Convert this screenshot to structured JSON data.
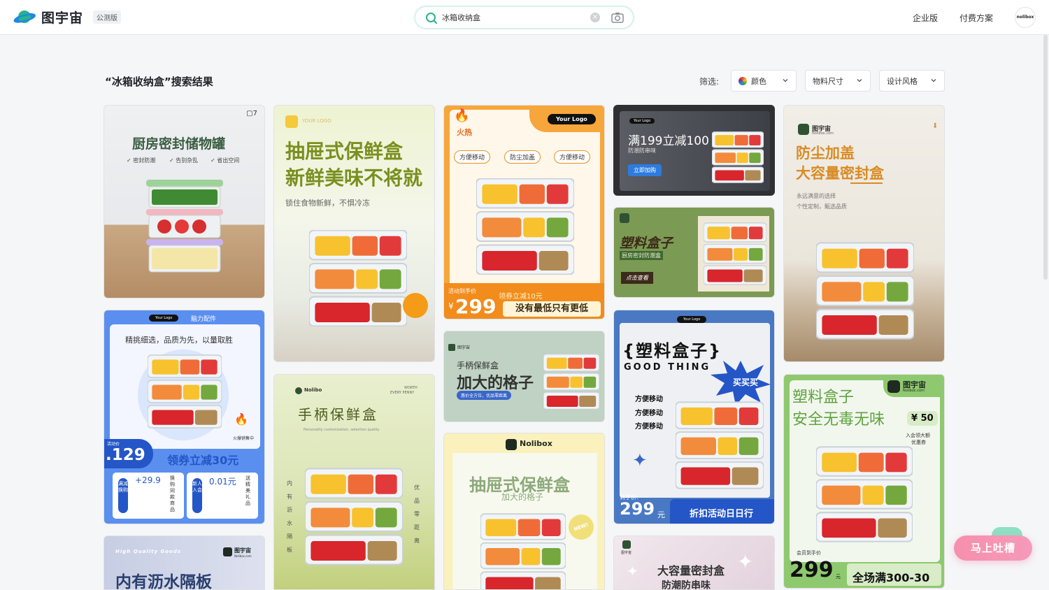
{
  "header": {
    "brand": "图宇宙",
    "badge": "公测版",
    "search_value": "冰箱收纳盒",
    "clear_symbol": "×",
    "links": [
      "企业版",
      "付费方案"
    ],
    "avatar_text": "nolibox"
  },
  "results": {
    "title": "“冰箱收纳盒”搜索结果",
    "filter_label": "筛选:",
    "filters": [
      "颜色",
      "物料尺寸",
      "设计风格"
    ]
  },
  "cards": {
    "c1": {
      "page_count": "7",
      "title": "厨房密封储物罐",
      "tags": [
        "密封防潮",
        "告别杂乱",
        "省出空间"
      ]
    },
    "c2": {
      "logo": "YOUR LOGO",
      "title1": "抽屉式保鲜盒",
      "title2": "新鲜美味不将就",
      "subtitle": "锁住食物新鲜，不惧冷冻"
    },
    "c3": {
      "badge": "火热",
      "tags": [
        "方便移动",
        "防尘加盖",
        "方便移动"
      ],
      "logo": "Your Logo",
      "price_label": "活动到手价",
      "price": "299",
      "currency": "¥",
      "coupon": "领券立减10元",
      "slogan": "没有最低只有更低"
    },
    "c4": {
      "logo": "Your Logo",
      "title": "满199立减100",
      "subtitle": "防潮防串味",
      "button": "立即加购"
    },
    "c5": {
      "brand": "图宇宙",
      "brand_sub": "Nolibox.com",
      "title1": "防尘加盖",
      "title2": "大容量密封盒",
      "line1": "永远满意的选择",
      "line2": "个性定制，甄选品质"
    },
    "c6": {
      "logo": "Your Logo",
      "category": "脑力配件",
      "headline": "精挑细选，品质为先，以量取胜",
      "hot": "火爆销售中",
      "price_label": "活动价",
      "price": ".129",
      "coupon": "领券立减30元",
      "offer1_tag": "满减换购",
      "offer1_price": "+29.9",
      "offer1_desc": "换购同款商品",
      "offer2_tag": "新人入会",
      "offer2_price": "0.01元",
      "offer2_desc": "送精美礼品"
    },
    "c7": {
      "brand": "图宇宙",
      "title": "塑料盒子",
      "subtitle": "厨房密封防潮盒",
      "button": "点击查看"
    },
    "c8": {
      "brand": "图宇宙",
      "title1": "手柄保鲜盒",
      "title2": "加大的格子",
      "badge": "惠价全方位，优品零距离"
    },
    "c9": {
      "logo": "Your Logo",
      "title": "{塑料盒子}",
      "subtitle": "GOOD THING",
      "burst": "买买买",
      "features": [
        "方便移动",
        "方便移动",
        "方便移动"
      ],
      "price_label": "到手价:",
      "price": "299",
      "unit": "元",
      "banner": "折扣活动日日行"
    },
    "c10": {
      "brand": "Nolibo",
      "worth1": "WORTH",
      "worth2": "EVERY PENNY",
      "title": "手柄保鲜盒",
      "subtitle": "Personality customization, selection quality",
      "left_v": "内有沥水隔板",
      "right_v": "优品零距离"
    },
    "c11": {
      "brand": "Nolibox",
      "title": "抽屉式保鲜盒",
      "subtitle": "加大的格子",
      "badge": "NEW!"
    },
    "c12": {
      "brand": "图宇宙",
      "brand_sub": "Nolibox.com",
      "title1": "塑料盒子",
      "title2": "安全无毒无味",
      "price": "¥ 50",
      "note1": "入会领大额",
      "note2": "优惠券",
      "price_label": "会员到手价",
      "price2": "299",
      "unit": "元",
      "banner": "全场满300-30"
    },
    "c13": {
      "tag": "High Quality Goods",
      "brand": "图宇宙",
      "brand_sub": "Nolibox.com",
      "title": "内有沥水隔板"
    },
    "c14": {
      "brand": "图宇宙",
      "title1": "大容量密封盒",
      "title2": "防潮防串味"
    }
  },
  "feedback": {
    "label": "马上吐槽"
  },
  "colors": {
    "accent": "#2bb389",
    "brand_blue": "#2e7be0",
    "orange": "#f5a623",
    "green": "#7fa35a"
  }
}
